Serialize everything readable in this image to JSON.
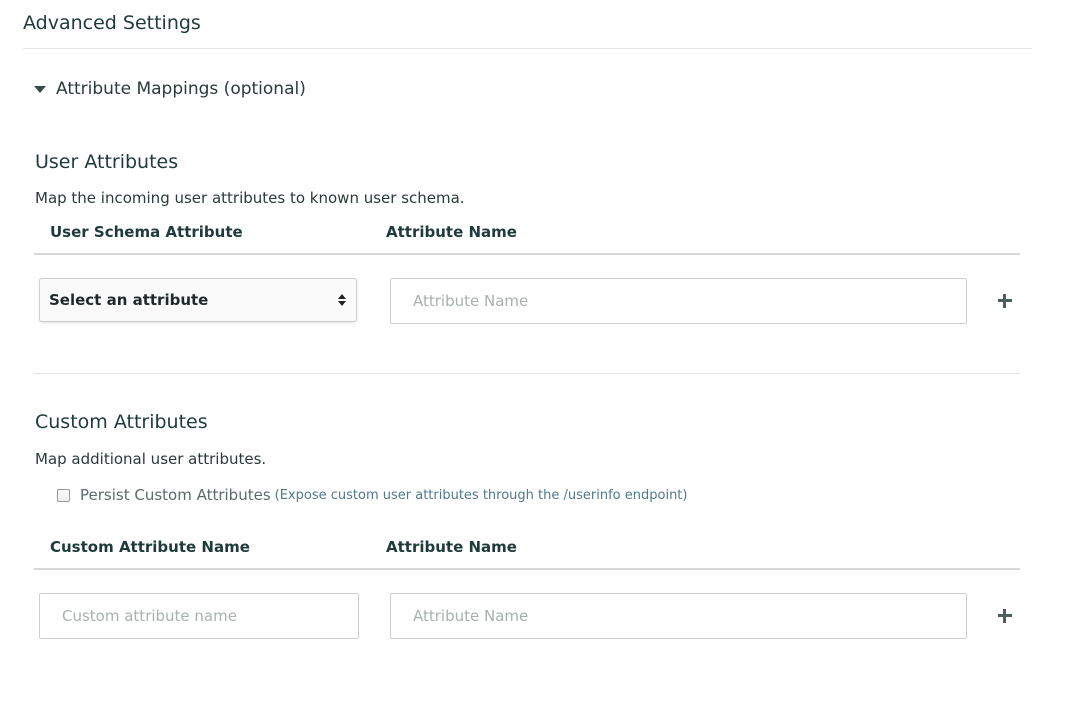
{
  "header": {
    "title": "Advanced Settings"
  },
  "collapsible": {
    "label": "Attribute Mappings (optional)"
  },
  "user_attributes": {
    "title": "User Attributes",
    "description": "Map the incoming user attributes to known user schema.",
    "columns": [
      "User Schema Attribute",
      "Attribute Name"
    ],
    "select_label": "Select an attribute",
    "name_placeholder": "Attribute Name"
  },
  "custom_attributes": {
    "title": "Custom Attributes",
    "description": "Map additional user attributes.",
    "persist_label": "Persist Custom Attributes",
    "persist_hint": "(Expose custom user attributes through the /userinfo endpoint)",
    "persist_checked": false,
    "columns": [
      "Custom Attribute Name",
      "Attribute Name"
    ],
    "custom_placeholder": "Custom attribute name",
    "name_placeholder": "Attribute Name"
  },
  "icons": {
    "collapse": "caret-down-icon",
    "add": "plus-icon",
    "select": "select-arrows-icon"
  }
}
